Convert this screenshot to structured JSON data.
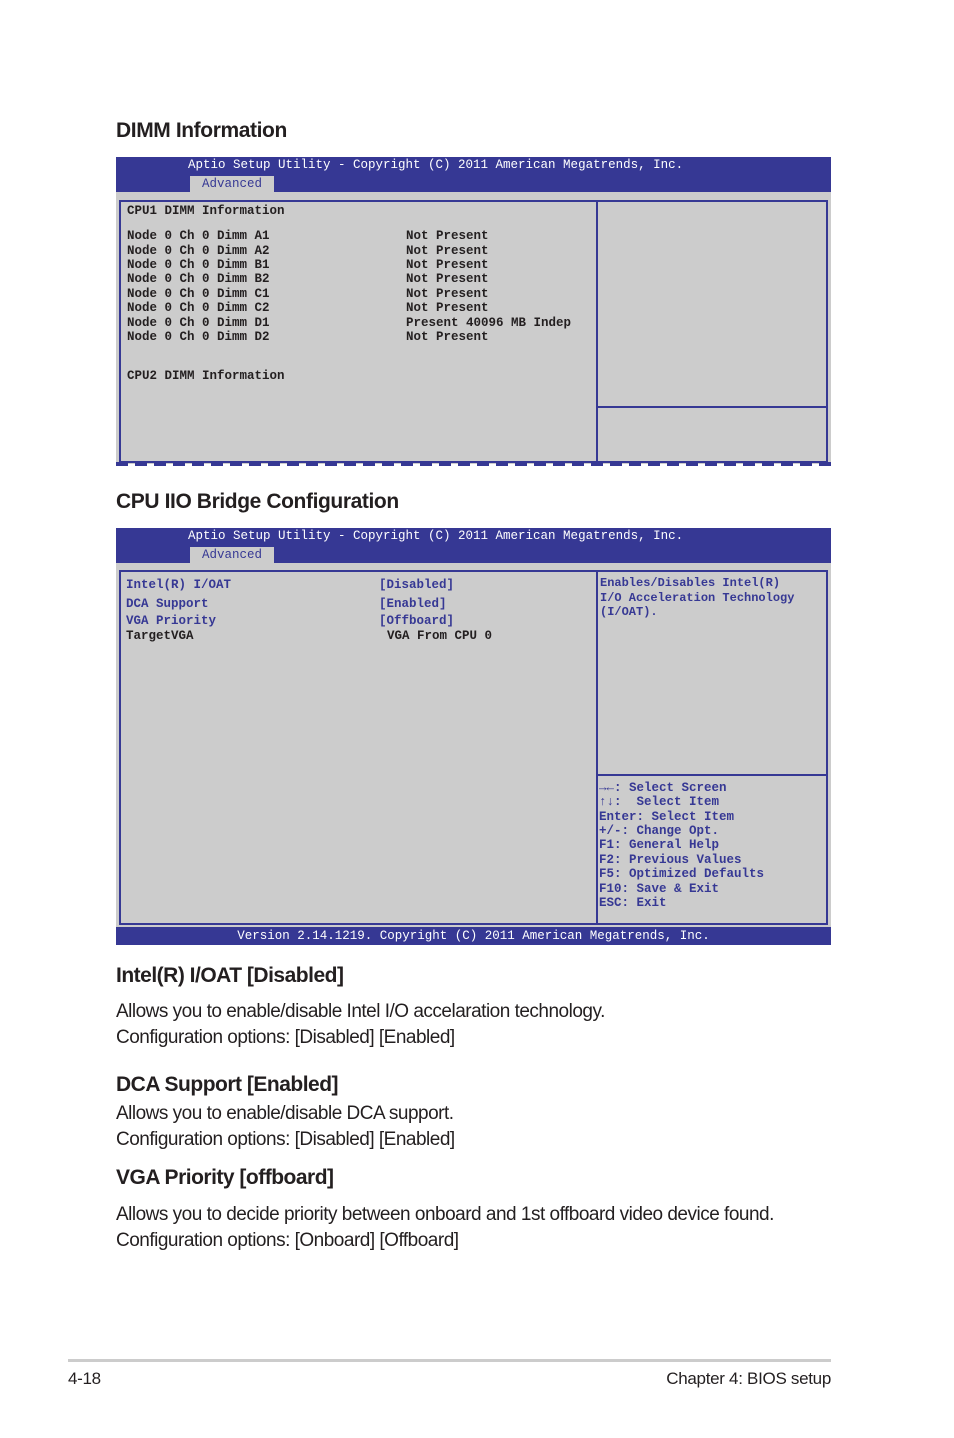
{
  "dimm_section": {
    "title": "DIMM Information",
    "bios": {
      "header_title": "Aptio Setup Utility - Copyright (C) 2011 American Megatrends, Inc.",
      "active_tab": "Advanced",
      "cpu1_heading": "CPU1 DIMM Information",
      "rows": [
        {
          "label": "Node 0 Ch 0 Dimm A1",
          "value": "Not Present"
        },
        {
          "label": "Node 0 Ch 0 Dimm A2",
          "value": "Not Present"
        },
        {
          "label": "Node 0 Ch 0 Dimm B1",
          "value": "Not Present"
        },
        {
          "label": "Node 0 Ch 0 Dimm B2",
          "value": "Not Present"
        },
        {
          "label": "Node 0 Ch 0 Dimm C1",
          "value": "Not Present"
        },
        {
          "label": "Node 0 Ch 0 Dimm C2",
          "value": "Not Present"
        },
        {
          "label": "Node 0 Ch 0 Dimm D1",
          "value": "Present 40096 MB Indep"
        },
        {
          "label": "Node 0 Ch 0 Dimm D2",
          "value": "Not Present"
        }
      ],
      "cpu2_heading": "CPU2 DIMM Information"
    }
  },
  "iio_section": {
    "title": "CPU IIO Bridge Configuration",
    "bios": {
      "header_title": "Aptio Setup Utility - Copyright (C) 2011 American Megatrends, Inc.",
      "active_tab": "Advanced",
      "items": [
        {
          "label": "Intel(R) I/OAT",
          "value": "[Disabled]"
        },
        {
          "label": "DCA Support",
          "value": "[Enabled]"
        },
        {
          "label": "VGA Priority",
          "value": "[Offboard]"
        },
        {
          "label": "TargetVGA",
          "value": "VGA From CPU 0"
        }
      ],
      "help_text": [
        "Enables/Disables Intel(R)",
        "I/O Acceleration Technology",
        "(I/OAT)."
      ],
      "keys": [
        "→←: Select Screen",
        "↑↓:  Select Item",
        "Enter: Select Item",
        "+/-: Change Opt.",
        "F1: General Help",
        "F2: Previous Values",
        "F5: Optimized Defaults",
        "F10: Save & Exit",
        "ESC: Exit"
      ],
      "footer": "Version 2.14.1219. Copyright (C) 2011 American Megatrends, Inc."
    }
  },
  "descriptions": [
    {
      "title": "Intel(R) I/OAT [Disabled]",
      "lines": [
        "Allows you to enable/disable Intel I/O accelaration technology.",
        "Configuration options: [Disabled] [Enabled]"
      ]
    },
    {
      "title": "DCA Support [Enabled]",
      "lines": [
        "Allows you to enable/disable DCA support.",
        "Configuration options: [Disabled] [Enabled]"
      ]
    },
    {
      "title": "VGA Priority [offboard]",
      "lines": [
        "Allows you to decide priority between onboard and 1st offboard video device found.",
        "Configuration options: [Onboard] [Offboard]"
      ]
    }
  ],
  "page_footer": {
    "page_number": "4-18",
    "chapter": "Chapter 4: BIOS setup"
  },
  "colors": {
    "bios_blue": "#363894",
    "bios_gray": "#cccccc"
  }
}
